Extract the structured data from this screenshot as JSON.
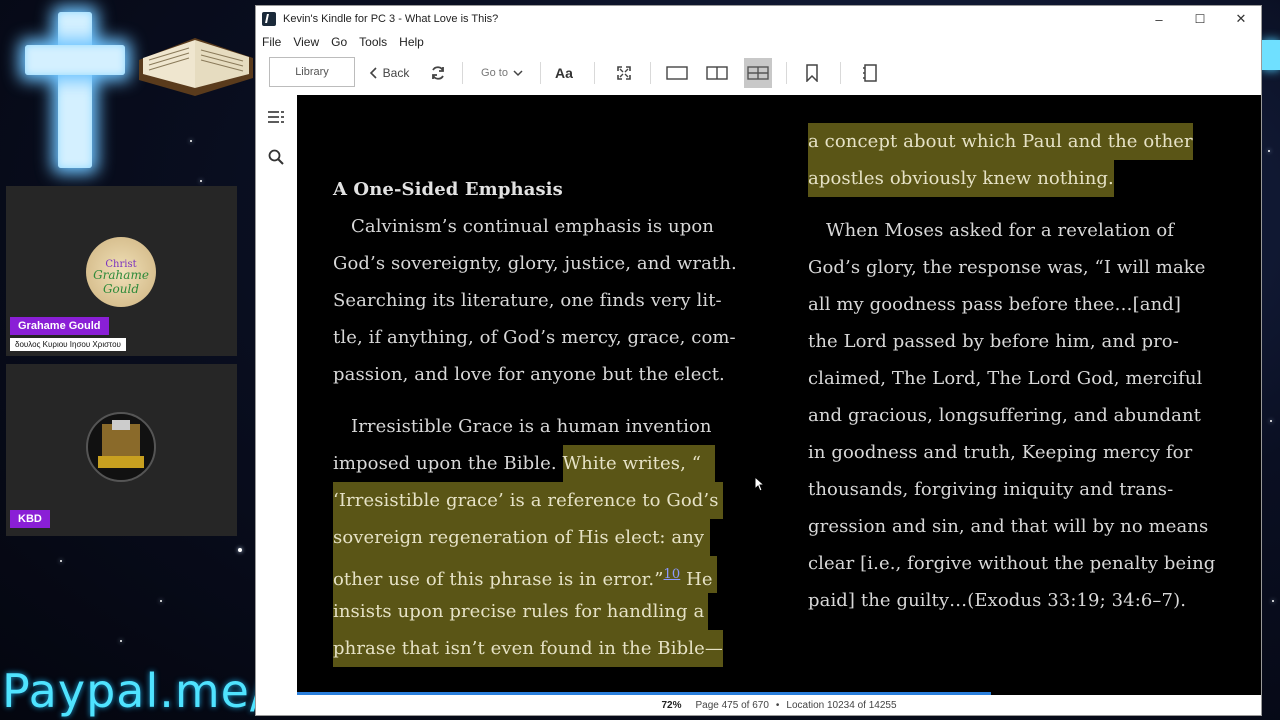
{
  "window": {
    "title": "Kevin's Kindle for PC 3 - What Love is This?",
    "controls": {
      "minimize": "–",
      "maximize": "☐",
      "close": "✕"
    }
  },
  "menu": [
    "File",
    "View",
    "Go",
    "Tools",
    "Help"
  ],
  "toolbar": {
    "library": "Library",
    "back": "Back",
    "goto": "Go to",
    "font": "Aa"
  },
  "book": {
    "left": {
      "heading": "A One-Sided Emphasis",
      "p1": [
        "Calvinism’s continual emphasis is upon",
        "God’s sovereignty, glory, justice, and wrath.",
        "Searching its literature, one finds very lit-",
        "tle, if anything, of God’s mercy, grace, com-",
        "passion, and love for anyone but the elect."
      ],
      "p2_line1": "Irresistible Grace is a human invention",
      "p2_line2_plain": "imposed upon the Bible. ",
      "p2_line2_hl": "White writes, “",
      "p2_hl_lines": [
        "‘Irresistible grace’ is a reference to God’s",
        "sovereign regeneration of His elect: any"
      ],
      "p2_line5_hl": "other use of this phrase is in error.”",
      "footnote": "10",
      "p2_line5_hl_after": " He",
      "p2_hl_tail": [
        "insists upon precise rules for handling a",
        "phrase that isn’t even found in the Bible—"
      ]
    },
    "right": {
      "hl_lines": [
        "a concept about which Paul and the other",
        "apostles obviously knew nothing."
      ],
      "p_lines": [
        "When Moses asked for a revelation of",
        "God’s glory, the response was, “I will make",
        "all my goodness pass before thee…[and]",
        "the Lord passed by before him, and pro-",
        "claimed, The Lord, The Lord God, merciful",
        "and gracious, longsuffering, and abundant",
        "in goodness and truth, Keeping mercy for",
        "thousands, forgiving iniquity and trans-",
        "gression and sin, and that will by no means",
        "clear [i.e., forgive without the penalty being",
        "paid] the guilty…(Exodus 33:19; 34:6–7)."
      ]
    }
  },
  "status": {
    "percent": "72%",
    "page": "Page 475 of 670",
    "location": "Location 10234 of 14255",
    "progress_fraction": 0.72
  },
  "overlay": {
    "user1_name": "Grahame Gould",
    "user1_sub": "δουλος Κυριου Ιησου Χριστου",
    "user2_name": "KBD",
    "paypal": "Paypal.me/"
  },
  "colors": {
    "highlight": "#5a5516",
    "accent": "#8a1fd6",
    "progress": "#2a7fdc"
  }
}
